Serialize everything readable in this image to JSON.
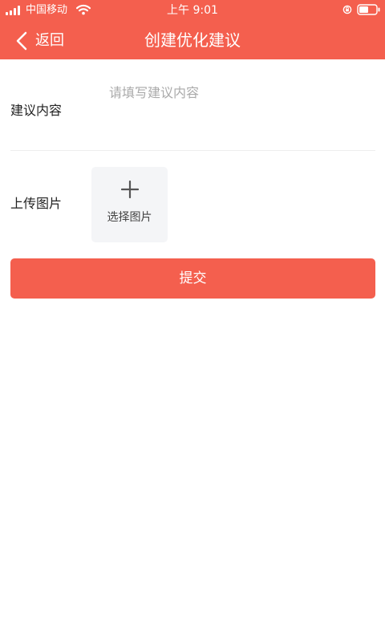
{
  "status_bar": {
    "carrier": "中国移动",
    "time": "上午 9:01",
    "signal_icon": "cellular-signal-icon",
    "wifi_icon": "wifi-icon",
    "rotation_lock_icon": "rotation-lock-icon",
    "battery_icon": "battery-icon"
  },
  "navbar": {
    "back_label": "返回",
    "back_icon": "chevron-left-icon",
    "title": "创建优化建议",
    "background_color": "#f45f4e"
  },
  "form": {
    "suggestion": {
      "label": "建议内容",
      "value": "",
      "placeholder": "请填写建议内容"
    },
    "upload": {
      "label": "上传图片",
      "picker_label": "选择图片",
      "picker_icon": "plus-icon"
    },
    "submit_label": "提交",
    "accent_color": "#f45f4e"
  }
}
